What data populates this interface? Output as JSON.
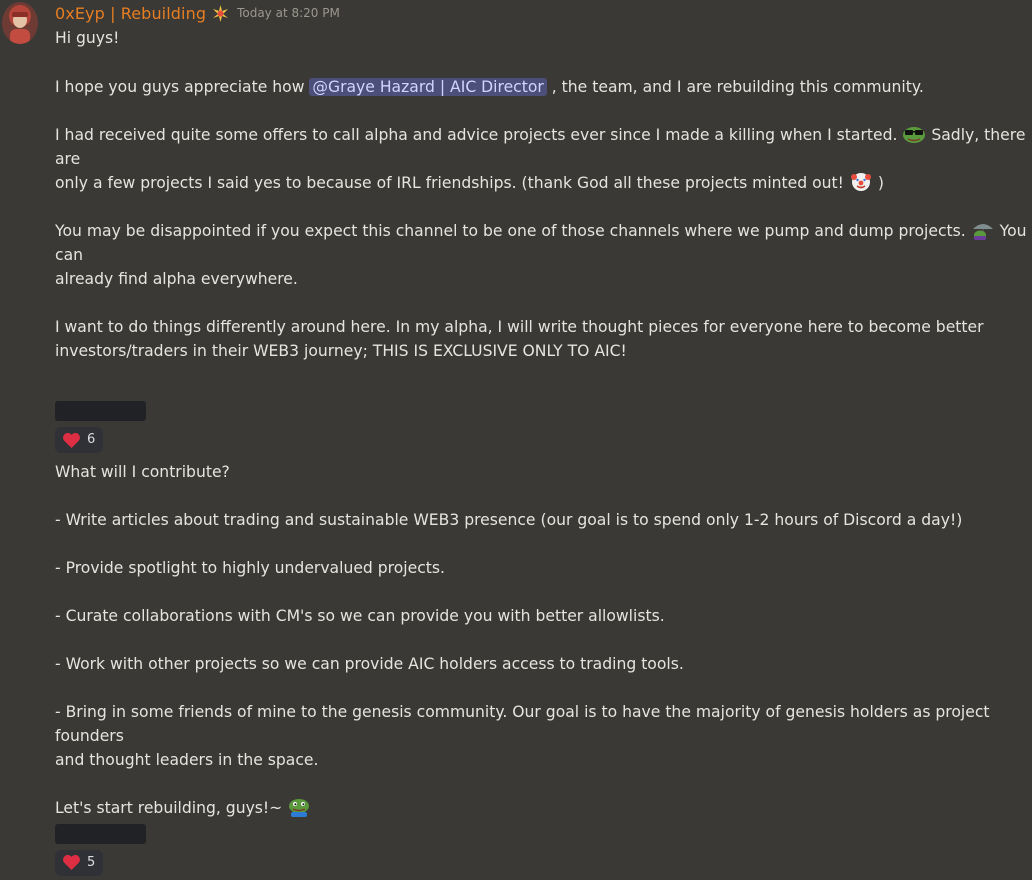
{
  "author": {
    "name": "0xEyp | Rebuilding",
    "badge_icon": "sparkle-burst-icon",
    "timestamp": "Today at 8:20 PM",
    "avatar_icon": "user-avatar"
  },
  "message": {
    "greeting": "Hi guys!",
    "p1_before": "I hope you guys appreciate how ",
    "mention": "@Graye Hazard | AIC Director",
    "p1_after": " , the team, and I are rebuilding this community.",
    "p2_a": "I had received quite some offers to call alpha and advice projects ever since I made a killing when I started. ",
    "p2_b": " Sadly, there are",
    "p2_c": "only a few projects I said yes to because of IRL friendships. (thank God all these projects minted out! ",
    "p2_d": " )",
    "p3_a": "You may be disappointed if you expect this channel to be one of those channels where we pump and dump projects. ",
    "p3_b": "  You can",
    "p3_c": "already find alpha everywhere.",
    "p4_a": "I want to do things differently around here. In my alpha, I will write thought pieces for everyone here to become better",
    "p4_b": "investors/traders in their WEB3 journey; THIS IS EXCLUSIVE ONLY TO AIC!",
    "q": "What will I contribute?",
    "b1": "- Write articles about trading and sustainable WEB3 presence (our goal is to spend only 1-2 hours of Discord a day!)",
    "b2": "- Provide spotlight to highly undervalued projects.",
    "b3": "- Curate collaborations with CM's so we can provide you with better allowlists.",
    "b4": "- Work with other projects so we can provide AIC holders access to trading tools.",
    "b5_a": "- Bring in some friends of mine to the genesis community. Our goal is to have the majority of genesis holders as project founders",
    "b5_b": "and thought leaders in the space.",
    "closing": "Let's start rebuilding, guys!~ "
  },
  "reactions": [
    {
      "emoji": "red-heart-icon",
      "count": "6"
    },
    {
      "emoji": "red-heart-icon",
      "count": "5"
    }
  ],
  "emojis": [
    "pepe-sunglasses-icon",
    "clown-face-icon",
    "pepe-umbrella-icon",
    "pepe-smile-icon"
  ],
  "colors": {
    "background": "#3b3935",
    "username": "#e67e22",
    "mention_bg": "#4c4f7a",
    "reaction_bg": "#2f3136",
    "redaction": "#202225"
  }
}
